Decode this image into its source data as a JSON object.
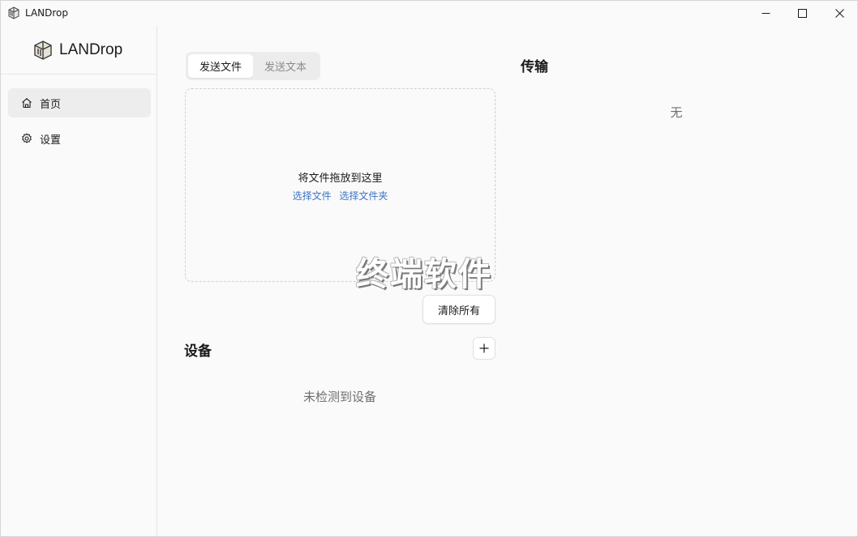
{
  "window": {
    "title": "LANDrop",
    "controls": {
      "minimize_icon": "minimize-icon",
      "maximize_icon": "maximize-icon",
      "close_icon": "close-icon"
    }
  },
  "sidebar": {
    "brand": "LANDrop",
    "items": [
      {
        "label": "首页",
        "icon": "home-icon",
        "active": true
      },
      {
        "label": "设置",
        "icon": "gear-icon",
        "active": false
      }
    ]
  },
  "send": {
    "tabs": [
      {
        "label": "发送文件",
        "active": true
      },
      {
        "label": "发送文本",
        "active": false
      }
    ],
    "dropzone": {
      "hint": "将文件拖放到这里",
      "select_files": "选择文件",
      "select_folder": "选择文件夹"
    },
    "clear_all": "清除所有"
  },
  "devices": {
    "title": "设备",
    "add_icon": "plus-icon",
    "empty": "未检测到设备"
  },
  "transfer": {
    "title": "传输",
    "empty": "无"
  },
  "watermark": "终端软件",
  "colors": {
    "background": "#fafafa",
    "link": "#3b73c5",
    "active_nav": "#ededed",
    "muted_text": "#6e6e6e"
  }
}
